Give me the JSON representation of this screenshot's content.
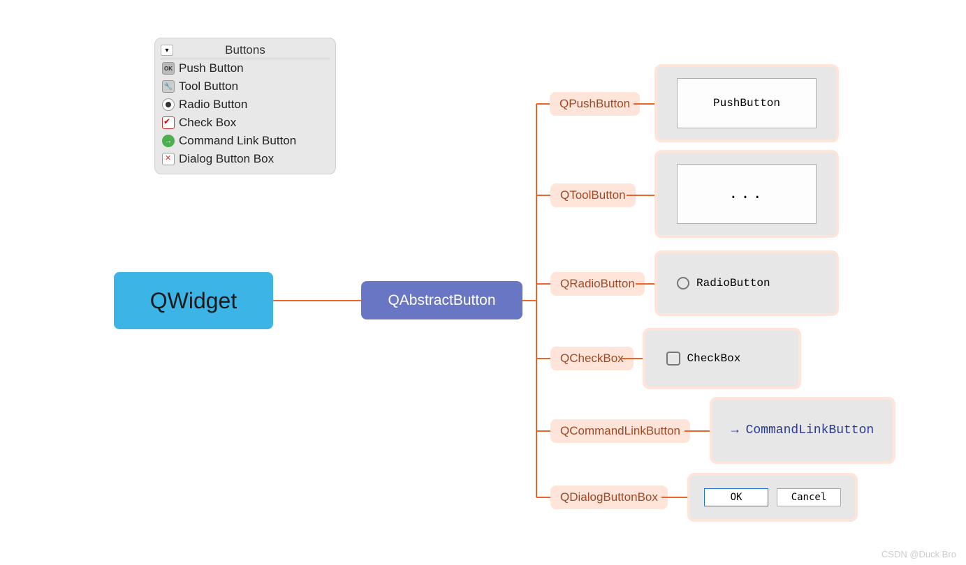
{
  "panel": {
    "title": "Buttons",
    "items": [
      "Push Button",
      "Tool Button",
      "Radio Button",
      "Check Box",
      "Command Link Button",
      "Dialog Button Box"
    ]
  },
  "root": {
    "label": "QWidget"
  },
  "abstract": {
    "label": "QAbstractButton"
  },
  "leaves": [
    {
      "name": "QPushButton",
      "preview": "PushButton"
    },
    {
      "name": "QToolButton",
      "preview": "..."
    },
    {
      "name": "QRadioButton",
      "preview": "RadioButton"
    },
    {
      "name": "QCheckBox",
      "preview": "CheckBox"
    },
    {
      "name": "QCommandLinkButton",
      "preview": "CommandLinkButton"
    },
    {
      "name": "QDialogButtonBox",
      "preview_ok": "OK",
      "preview_cancel": "Cancel"
    }
  ],
  "watermark": "CSDN @Duck Bro"
}
